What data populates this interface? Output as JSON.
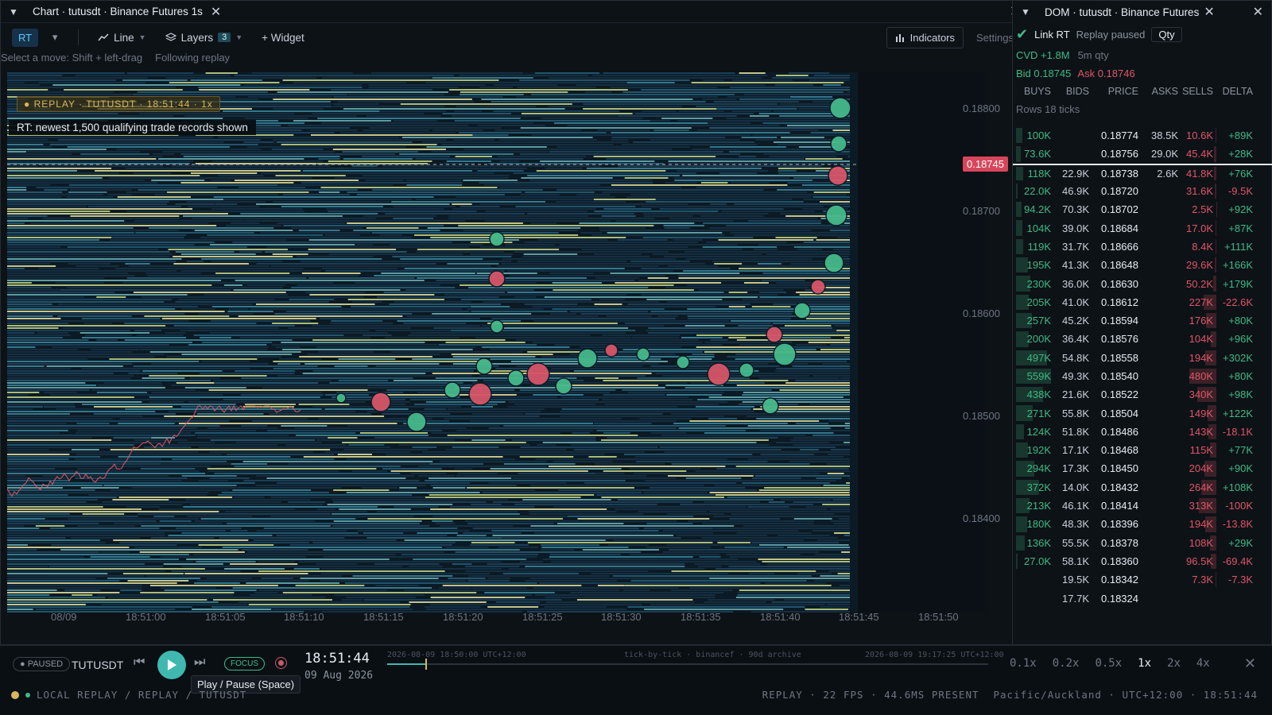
{
  "chart_window": {
    "title": "Chart · tutusdt · Binance Futures 1s",
    "toolbar": {
      "rt": "RT",
      "line": "Line",
      "layers": "Layers",
      "layers_count": "3",
      "widget": "+ Widget",
      "indicators": "Indicators",
      "settings": "Settings"
    },
    "hint_drag": "Select a move: Shift + left-drag",
    "hint_follow": "Following replay",
    "replay_tag": "● REPLAY · TUTUSDT · 18:51:44 · 1x",
    "rt_note": "RT: newest 1,500 qualifying trade records shown",
    "current_price": "0.18745",
    "y_ticks": [
      "0.18800",
      "0.18700",
      "0.18600",
      "0.18500",
      "0.18400"
    ],
    "x_ticks": [
      "08/09",
      "18:51:00",
      "18:51:05",
      "18:51:10",
      "18:51:15",
      "18:51:20",
      "18:51:25",
      "18:51:30",
      "18:51:35",
      "18:51:40",
      "18:51:45",
      "18:51:50"
    ]
  },
  "dom_window": {
    "title": "DOM · tutusdt · Binance Futures",
    "link_rt": "Link RT",
    "replay_paused": "Replay paused",
    "qty": "Qty",
    "cvd": "CVD +1.8M",
    "cvd_window": "5m qty",
    "bid": "Bid 0.18745",
    "ask": "Ask 0.18746",
    "headers": [
      "BUYS",
      "BIDS",
      "PRICE",
      "ASKS",
      "SELLS",
      "DELTA"
    ],
    "rows_label": "Rows 18 ticks",
    "rows": [
      {
        "buys": "100K",
        "bids": "",
        "price": "0.18774",
        "asks": "38.5K",
        "sells": "10.6K",
        "delta": "+89K"
      },
      {
        "buys": "73.6K",
        "bids": "",
        "price": "0.18756",
        "asks": "29.0K",
        "sells": "45.4K",
        "delta": "+28K"
      },
      {
        "buys": "118K",
        "bids": "22.9K",
        "price": "0.18738",
        "asks": "2.6K",
        "sells": "41.8K",
        "delta": "+76K"
      },
      {
        "buys": "22.0K",
        "bids": "46.9K",
        "price": "0.18720",
        "asks": "",
        "sells": "31.6K",
        "delta": "-9.5K"
      },
      {
        "buys": "94.2K",
        "bids": "70.3K",
        "price": "0.18702",
        "asks": "",
        "sells": "2.5K",
        "delta": "+92K"
      },
      {
        "buys": "104K",
        "bids": "39.0K",
        "price": "0.18684",
        "asks": "",
        "sells": "17.0K",
        "delta": "+87K"
      },
      {
        "buys": "119K",
        "bids": "31.7K",
        "price": "0.18666",
        "asks": "",
        "sells": "8.4K",
        "delta": "+111K"
      },
      {
        "buys": "195K",
        "bids": "41.3K",
        "price": "0.18648",
        "asks": "",
        "sells": "29.6K",
        "delta": "+166K"
      },
      {
        "buys": "230K",
        "bids": "36.0K",
        "price": "0.18630",
        "asks": "",
        "sells": "50.2K",
        "delta": "+179K"
      },
      {
        "buys": "205K",
        "bids": "41.0K",
        "price": "0.18612",
        "asks": "",
        "sells": "227K",
        "delta": "-22.6K"
      },
      {
        "buys": "257K",
        "bids": "45.2K",
        "price": "0.18594",
        "asks": "",
        "sells": "176K",
        "delta": "+80K"
      },
      {
        "buys": "200K",
        "bids": "36.4K",
        "price": "0.18576",
        "asks": "",
        "sells": "104K",
        "delta": "+96K"
      },
      {
        "buys": "497K",
        "bids": "54.8K",
        "price": "0.18558",
        "asks": "",
        "sells": "194K",
        "delta": "+302K"
      },
      {
        "buys": "559K",
        "bids": "49.3K",
        "price": "0.18540",
        "asks": "",
        "sells": "480K",
        "delta": "+80K"
      },
      {
        "buys": "438K",
        "bids": "21.6K",
        "price": "0.18522",
        "asks": "",
        "sells": "340K",
        "delta": "+98K"
      },
      {
        "buys": "271K",
        "bids": "55.8K",
        "price": "0.18504",
        "asks": "",
        "sells": "149K",
        "delta": "+122K"
      },
      {
        "buys": "124K",
        "bids": "51.8K",
        "price": "0.18486",
        "asks": "",
        "sells": "143K",
        "delta": "-18.1K"
      },
      {
        "buys": "192K",
        "bids": "17.1K",
        "price": "0.18468",
        "asks": "",
        "sells": "115K",
        "delta": "+77K"
      },
      {
        "buys": "294K",
        "bids": "17.3K",
        "price": "0.18450",
        "asks": "",
        "sells": "204K",
        "delta": "+90K"
      },
      {
        "buys": "372K",
        "bids": "14.0K",
        "price": "0.18432",
        "asks": "",
        "sells": "264K",
        "delta": "+108K"
      },
      {
        "buys": "213K",
        "bids": "46.1K",
        "price": "0.18414",
        "asks": "",
        "sells": "313K",
        "delta": "-100K"
      },
      {
        "buys": "180K",
        "bids": "48.3K",
        "price": "0.18396",
        "asks": "",
        "sells": "194K",
        "delta": "-13.8K"
      },
      {
        "buys": "136K",
        "bids": "55.5K",
        "price": "0.18378",
        "asks": "",
        "sells": "108K",
        "delta": "+29K"
      },
      {
        "buys": "27.0K",
        "bids": "58.1K",
        "price": "0.18360",
        "asks": "",
        "sells": "96.5K",
        "delta": "-69.4K"
      },
      {
        "buys": "",
        "bids": "19.5K",
        "price": "0.18342",
        "asks": "",
        "sells": "7.3K",
        "delta": "-7.3K"
      },
      {
        "buys": "",
        "bids": "17.7K",
        "price": "0.18324",
        "asks": "",
        "sells": "",
        "delta": ""
      }
    ]
  },
  "bottom": {
    "paused": "● PAUSED",
    "symbol": "TUTUSDT",
    "focus": "FOCUS",
    "time": "18:51:44",
    "date": "09 Aug 2026",
    "tooltip": "Play / Pause (Space)",
    "track_start": "2026-08-09 18:50:00 UTC+12:00",
    "track_mid": "tick-by-tick · binancef · 90d archive",
    "track_end": "2026-08-09 19:17:25 UTC+12:00",
    "speeds": [
      "0.1x",
      "0.2x",
      "0.5x",
      "1x",
      "2x",
      "4x"
    ],
    "status_left": "LOCAL REPLAY / REPLAY / TUTUSDT",
    "status_replay": "REPLAY · 22 FPS · 44.6MS PRESENT",
    "status_tz": "Pacific/Auckland · UTC+12:00 · 18:51:44"
  },
  "colors": {
    "buy": "#3fb984",
    "sell": "#e05566",
    "accent": "#3fb9b0",
    "price_tag": "#d8465b"
  }
}
